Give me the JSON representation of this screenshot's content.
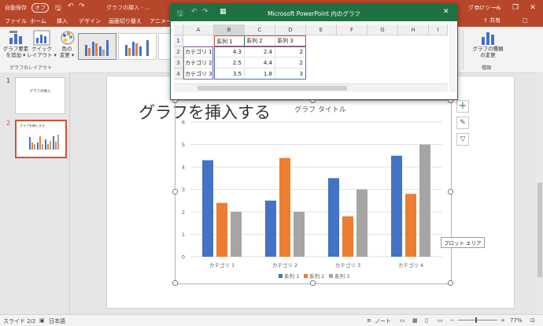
{
  "titlebar": {
    "autosave": "自動保存",
    "autosave_state": "オフ",
    "doc_title": "グラフの挿入 - ...",
    "tools_title": "グラフツール",
    "min": "—",
    "restore": "❐",
    "close": "✕",
    "ribbon_opts": "▭"
  },
  "tabs": [
    {
      "label": "ファイル"
    },
    {
      "label": "ホーム"
    },
    {
      "label": "挿入"
    },
    {
      "label": "デザイン"
    },
    {
      "label": "画面切り替え"
    },
    {
      "label": "アニメー"
    }
  ],
  "ribbon_right": {
    "share": "共有",
    "comment": "□"
  },
  "ribbon": {
    "add_element": "グラフ要素\nを追加 ▾",
    "quick_layout": "クイック\nレイアウト ▾",
    "change_color": "色の\n変更 ▾",
    "layout_group": "グラフのレイアウト",
    "change_type": "グラフの種類\nの変更",
    "type_group": "種類"
  },
  "slides": [
    {
      "num": "1",
      "title": "グラフの挿入"
    },
    {
      "num": "2",
      "title": "グラフを挿入する"
    }
  ],
  "slide": {
    "title": "グラフを挿入する",
    "tooltip": "プロット エリア"
  },
  "excel": {
    "title": "Microsoft PowerPoint 内のグラフ",
    "undo": "↶",
    "redo": "↷",
    "columns": [
      "A",
      "B",
      "C",
      "D",
      "E",
      "F",
      "G",
      "H",
      "I"
    ],
    "rows": [
      [
        "1",
        "",
        "系列 1",
        "系列 2",
        "系列 3"
      ],
      [
        "2",
        "カテゴリ 1",
        "4.3",
        "2.4",
        "2"
      ],
      [
        "3",
        "カテゴリ 2",
        "2.5",
        "4.4",
        "2"
      ],
      [
        "4",
        "カテゴリ 3",
        "3.5",
        "1.8",
        "3"
      ]
    ],
    "close": "✕"
  },
  "chart_data": {
    "type": "bar",
    "title": "グラフ タイトル",
    "categories": [
      "カテゴリ 1",
      "カテゴリ 2",
      "カテゴリ 3",
      "カテゴリ 4"
    ],
    "series": [
      {
        "name": "系列 1",
        "values": [
          4.3,
          2.5,
          3.5,
          4.5
        ],
        "color": "#4472c4"
      },
      {
        "name": "系列 2",
        "values": [
          2.4,
          4.4,
          1.8,
          2.8
        ],
        "color": "#ed7d31"
      },
      {
        "name": "系列 3",
        "values": [
          2,
          2,
          3,
          5
        ],
        "color": "#a5a5a5"
      }
    ],
    "ylim": [
      0,
      6
    ],
    "yticks": [
      "0",
      "1",
      "2",
      "3",
      "4",
      "5",
      "6"
    ],
    "grid": true,
    "legend": "bottom"
  },
  "status": {
    "slide_info": "スライド 2/2",
    "lang": "日本語",
    "notes": "ノート",
    "zoom": "77%"
  }
}
